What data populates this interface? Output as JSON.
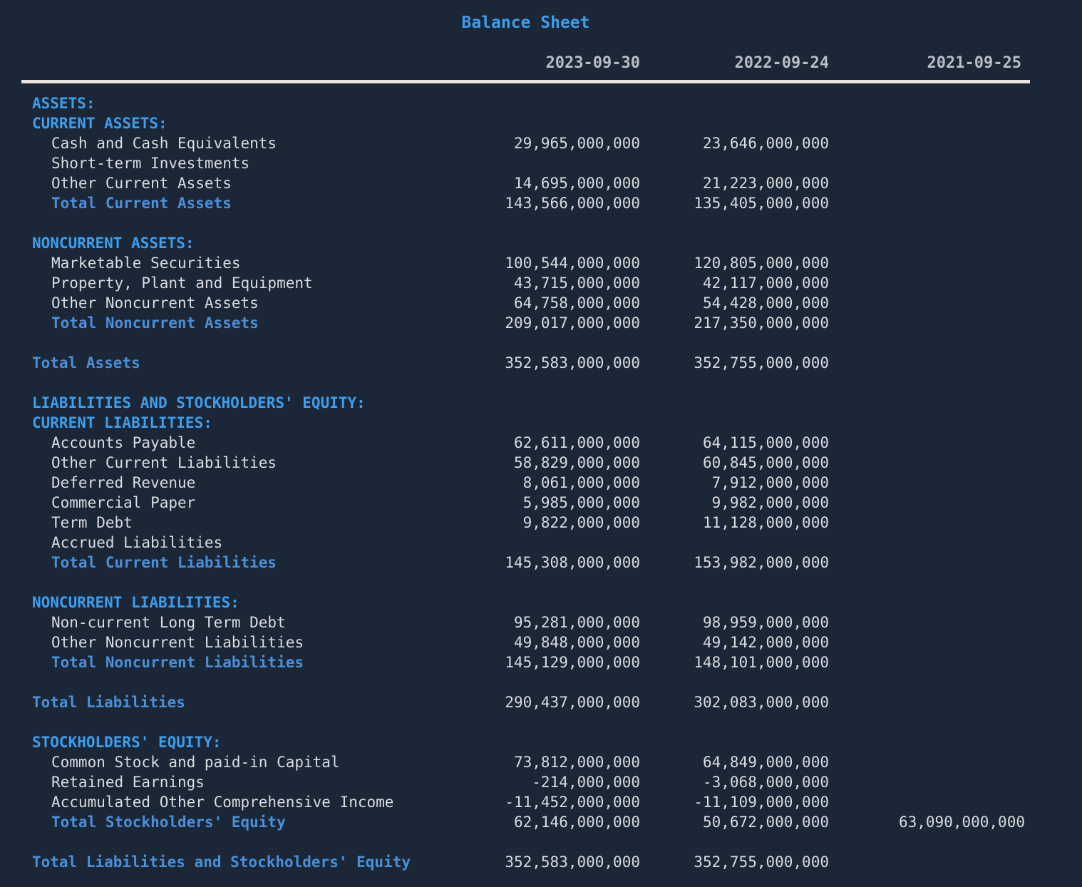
{
  "title": "Balance Sheet",
  "colors": {
    "background": "#1b2636",
    "title": "#3b9ff0",
    "section_header": "#3b9ff0",
    "subtotal": "#4a90d9",
    "value_text": "#d9dce1",
    "column_header": "#b9bdc6",
    "rule": "#eae4de"
  },
  "columns": [
    {
      "header": "2023-09-30"
    },
    {
      "header": "2022-09-24"
    },
    {
      "header": "2021-09-25"
    }
  ],
  "rows": [
    {
      "kind": "section",
      "indent": 0,
      "label": "ASSETS:",
      "values": [
        "",
        "",
        ""
      ]
    },
    {
      "kind": "section",
      "indent": 0,
      "label": "CURRENT ASSETS:",
      "values": [
        "",
        "",
        ""
      ]
    },
    {
      "kind": "item",
      "indent": 1,
      "label": "Cash and Cash Equivalents",
      "values": [
        "29,965,000,000",
        "23,646,000,000",
        ""
      ]
    },
    {
      "kind": "item",
      "indent": 1,
      "label": "Short-term Investments",
      "values": [
        "",
        "",
        ""
      ]
    },
    {
      "kind": "item",
      "indent": 1,
      "label": "Other Current Assets",
      "values": [
        "14,695,000,000",
        "21,223,000,000",
        ""
      ]
    },
    {
      "kind": "subtotal",
      "indent": 1,
      "label": "Total Current Assets",
      "values": [
        "143,566,000,000",
        "135,405,000,000",
        ""
      ]
    },
    {
      "kind": "spacer",
      "indent": 0,
      "label": "",
      "values": [
        "",
        "",
        ""
      ]
    },
    {
      "kind": "section",
      "indent": 0,
      "label": "NONCURRENT ASSETS:",
      "values": [
        "",
        "",
        ""
      ]
    },
    {
      "kind": "item",
      "indent": 1,
      "label": "Marketable Securities",
      "values": [
        "100,544,000,000",
        "120,805,000,000",
        ""
      ]
    },
    {
      "kind": "item",
      "indent": 1,
      "label": "Property, Plant and Equipment",
      "values": [
        "43,715,000,000",
        "42,117,000,000",
        ""
      ]
    },
    {
      "kind": "item",
      "indent": 1,
      "label": "Other Noncurrent Assets",
      "values": [
        "64,758,000,000",
        "54,428,000,000",
        ""
      ]
    },
    {
      "kind": "subtotal",
      "indent": 1,
      "label": "Total Noncurrent Assets",
      "values": [
        "209,017,000,000",
        "217,350,000,000",
        ""
      ]
    },
    {
      "kind": "spacer",
      "indent": 0,
      "label": "",
      "values": [
        "",
        "",
        ""
      ]
    },
    {
      "kind": "total",
      "indent": 0,
      "label": "Total Assets",
      "values": [
        "352,583,000,000",
        "352,755,000,000",
        ""
      ]
    },
    {
      "kind": "spacer",
      "indent": 0,
      "label": "",
      "values": [
        "",
        "",
        ""
      ]
    },
    {
      "kind": "section",
      "indent": 0,
      "label": "LIABILITIES AND STOCKHOLDERS' EQUITY:",
      "values": [
        "",
        "",
        ""
      ]
    },
    {
      "kind": "section",
      "indent": 0,
      "label": "CURRENT LIABILITIES:",
      "values": [
        "",
        "",
        ""
      ]
    },
    {
      "kind": "item",
      "indent": 1,
      "label": "Accounts Payable",
      "values": [
        "62,611,000,000",
        "64,115,000,000",
        ""
      ]
    },
    {
      "kind": "item",
      "indent": 1,
      "label": "Other Current Liabilities",
      "values": [
        "58,829,000,000",
        "60,845,000,000",
        ""
      ]
    },
    {
      "kind": "item",
      "indent": 1,
      "label": "Deferred Revenue",
      "values": [
        "8,061,000,000",
        "7,912,000,000",
        ""
      ]
    },
    {
      "kind": "item",
      "indent": 1,
      "label": "Commercial Paper",
      "values": [
        "5,985,000,000",
        "9,982,000,000",
        ""
      ]
    },
    {
      "kind": "item",
      "indent": 1,
      "label": "Term Debt",
      "values": [
        "9,822,000,000",
        "11,128,000,000",
        ""
      ]
    },
    {
      "kind": "item",
      "indent": 1,
      "label": "Accrued Liabilities",
      "values": [
        "",
        "",
        ""
      ]
    },
    {
      "kind": "subtotal",
      "indent": 1,
      "label": "Total Current Liabilities",
      "values": [
        "145,308,000,000",
        "153,982,000,000",
        ""
      ]
    },
    {
      "kind": "spacer",
      "indent": 0,
      "label": "",
      "values": [
        "",
        "",
        ""
      ]
    },
    {
      "kind": "section",
      "indent": 0,
      "label": "NONCURRENT LIABILITIES:",
      "values": [
        "",
        "",
        ""
      ]
    },
    {
      "kind": "item",
      "indent": 1,
      "label": "Non-current Long Term Debt",
      "values": [
        "95,281,000,000",
        "98,959,000,000",
        ""
      ]
    },
    {
      "kind": "item",
      "indent": 1,
      "label": "Other Noncurrent Liabilities",
      "values": [
        "49,848,000,000",
        "49,142,000,000",
        ""
      ]
    },
    {
      "kind": "subtotal",
      "indent": 1,
      "label": "Total Noncurrent Liabilities",
      "values": [
        "145,129,000,000",
        "148,101,000,000",
        ""
      ]
    },
    {
      "kind": "spacer",
      "indent": 0,
      "label": "",
      "values": [
        "",
        "",
        ""
      ]
    },
    {
      "kind": "total",
      "indent": 0,
      "label": "Total Liabilities",
      "values": [
        "290,437,000,000",
        "302,083,000,000",
        ""
      ]
    },
    {
      "kind": "spacer",
      "indent": 0,
      "label": "",
      "values": [
        "",
        "",
        ""
      ]
    },
    {
      "kind": "section",
      "indent": 0,
      "label": "STOCKHOLDERS' EQUITY:",
      "values": [
        "",
        "",
        ""
      ]
    },
    {
      "kind": "item",
      "indent": 1,
      "label": "Common Stock and paid-in Capital",
      "values": [
        "73,812,000,000",
        "64,849,000,000",
        ""
      ]
    },
    {
      "kind": "item",
      "indent": 1,
      "label": "Retained Earnings",
      "values": [
        "-214,000,000",
        "-3,068,000,000",
        ""
      ]
    },
    {
      "kind": "item",
      "indent": 1,
      "label": "Accumulated Other Comprehensive Income",
      "values": [
        "-11,452,000,000",
        "-11,109,000,000",
        ""
      ]
    },
    {
      "kind": "subtotal",
      "indent": 1,
      "label": "Total Stockholders' Equity",
      "values": [
        "62,146,000,000",
        "50,672,000,000",
        "63,090,000,000"
      ]
    },
    {
      "kind": "spacer",
      "indent": 0,
      "label": "",
      "values": [
        "",
        "",
        ""
      ]
    },
    {
      "kind": "total",
      "indent": 0,
      "label": "Total Liabilities and Stockholders' Equity",
      "values": [
        "352,583,000,000",
        "352,755,000,000",
        ""
      ]
    }
  ]
}
